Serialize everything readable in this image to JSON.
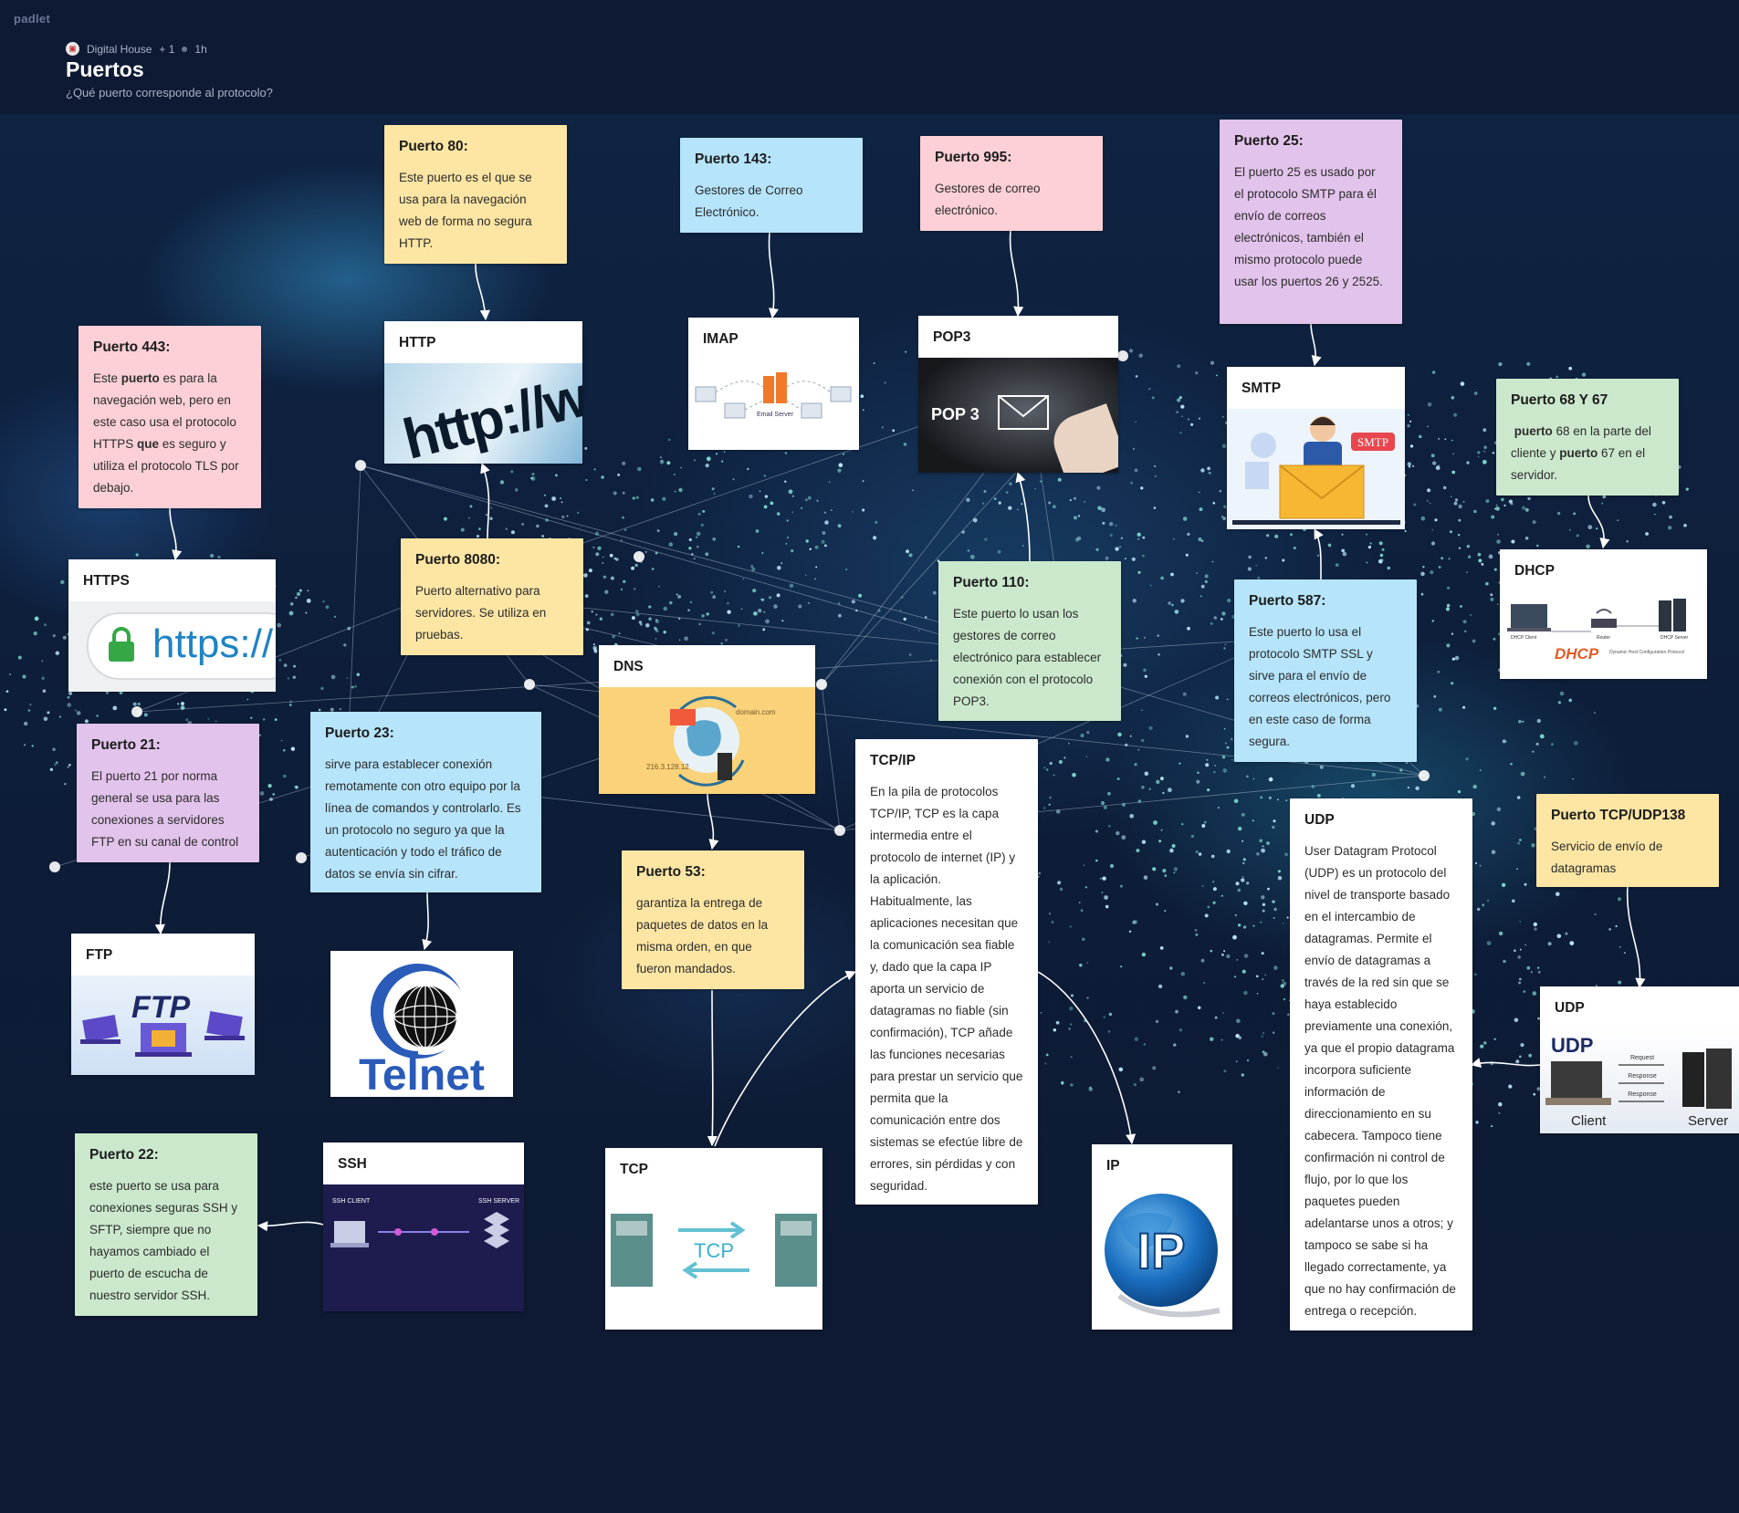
{
  "app": {
    "brand": "padlet"
  },
  "header": {
    "author": "Digital House",
    "plus": "+ 1",
    "time": "1h",
    "title": "Puertos",
    "subtitle": "¿Qué puerto corresponde al protocolo?"
  },
  "cards": {
    "p80": {
      "title": "Puerto 80:",
      "body": "Este puerto es el que se usa para la navegación web de forma no segura HTTP."
    },
    "p143": {
      "title": "Puerto 143:",
      "body": "Gestores de Correo Electrónico."
    },
    "p995": {
      "title": "Puerto 995:",
      "body": "Gestores de correo electrónico."
    },
    "p25": {
      "title": "Puerto 25:",
      "body": "El puerto 25 es usado por el protocolo SMTP para él envío de correos electrónicos, también el mismo protocolo puede usar los puertos 26 y 2525."
    },
    "p443": {
      "title": "Puerto 443:",
      "body_html_parts": [
        "Este ",
        "puerto",
        " es para la navegación web, pero en este caso usa el protocolo HTTPS ",
        "que",
        " es seguro y utiliza el protocolo TLS por debajo."
      ]
    },
    "p6867": {
      "title": "Puerto 68 Y 67",
      "body_parts": [
        "puerto",
        " 68 en la parte del cliente y ",
        "puerto",
        " 67 en el servidor."
      ]
    },
    "p8080": {
      "title": "Puerto 8080:",
      "body": "Puerto alternativo para servidores. Se utiliza en pruebas."
    },
    "p110": {
      "title": "Puerto 110:",
      "body": "Este puerto lo usan los gestores de correo electrónico para establecer conexión con el protocolo POP3."
    },
    "p587": {
      "title": "Puerto 587:",
      "body": "Este puerto lo usa el protocolo SMTP SSL y sirve para el envío de correos electrónicos, pero en este caso de forma segura."
    },
    "p21": {
      "title": "Puerto 21:",
      "body": "El puerto 21 por norma general se usa para las conexiones a servidores FTP en su canal de control"
    },
    "p23": {
      "title": "Puerto 23:",
      "body": "sirve para establecer conexión remotamente con otro equipo por la línea de comandos y controlarlo. Es un protocolo no seguro ya que la autenticación y todo el tráfico de datos se envía sin cifrar."
    },
    "tcpip": {
      "title": "TCP/IP",
      "body": "En la pila de protocolos TCP/IP, TCP es la capa intermedia entre el protocolo de internet (IP) y la aplicación. Habitualmente, las aplicaciones necesitan que la comunicación sea fiable y, dado que la capa IP aporta un servicio de datagramas no fiable (sin confirmación), TCP añade las funciones necesarias para prestar un servicio que permita que la comunicación entre dos sistemas se efectúe libre de errores, sin pérdidas y con seguridad."
    },
    "udptext": {
      "title": "UDP",
      "body": "User Datagram Protocol (UDP) es un protocolo del nivel de transporte basado en el intercambio de datagramas. Permite el envío de datagramas a través de la red sin que se haya establecido previamente una conexión, ya que el propio datagrama incorpora suficiente información de direccionamiento en su cabecera. Tampoco tiene confirmación ni control de flujo, por lo que los paquetes pueden adelantarse unos a otros; y tampoco se sabe si ha llegado correctamente, ya que no hay confirmación de entrega o recepción."
    },
    "p138": {
      "title": "Puerto TCP/UDP138",
      "body": "Servicio de envío de datagramas"
    },
    "p53": {
      "title": "Puerto 53:",
      "body": "garantiza la entrega de paquetes de datos en la misma orden, en que fueron mandados."
    },
    "p22": {
      "title": "Puerto 22:",
      "body": "este puerto se usa para conexiones seguras SSH y SFTP, siempre que no hayamos cambiado el puerto de escucha de nuestro servidor SSH."
    }
  },
  "image_cards": {
    "http": {
      "title": "HTTP",
      "img_text": "http://www"
    },
    "imap": {
      "title": "IMAP",
      "img_text": "Email Server"
    },
    "pop3": {
      "title": "POP3",
      "img_text": "POP 3"
    },
    "smtp": {
      "title": "SMTP",
      "img_text": "SMTP"
    },
    "https": {
      "title": "HTTPS",
      "img_text": "https://"
    },
    "dhcp": {
      "title": "DHCP",
      "img_text": "DHCP",
      "img_sub": "Dynamic Host Configuration Protocol",
      "client": "DHCP Client",
      "router": "Router",
      "server": "DHCP Server"
    },
    "dns": {
      "title": "DNS",
      "img_text": "domain.com",
      "ip": "216.3.128.12"
    },
    "ftp": {
      "title": "FTP",
      "img_text": "FTP"
    },
    "telnet": {
      "img_text": "Telnet"
    },
    "ssh": {
      "title": "SSH",
      "client": "SSH CLIENT",
      "server": "SSH SERVER"
    },
    "tcp": {
      "title": "TCP",
      "img_text": "TCP"
    },
    "ip": {
      "title": "IP",
      "img_text": "IP"
    },
    "udp": {
      "title": "UDP",
      "img_text": "UDP",
      "client": "Client",
      "server": "Server",
      "request": "Request",
      "response1": "Response",
      "response2": "Response"
    }
  },
  "colors": {
    "background": "#0e1a33",
    "yellow": "#fde6a4",
    "blue": "#b5e4fb",
    "pink": "#fcd0d6",
    "purple": "#e2c3eb",
    "green": "#cbe8cd"
  }
}
